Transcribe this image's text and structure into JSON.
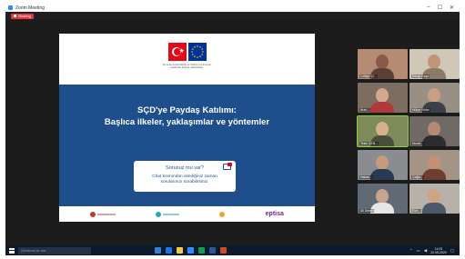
{
  "window": {
    "title": "Zoom Meeting",
    "controls": [
      "–",
      "☐",
      "✕"
    ]
  },
  "share_bar": {
    "label": "Sharing"
  },
  "slide": {
    "logo_caption_line1": "Bu proje Avrupa Birliği ve Türkiye Cumhuriyeti",
    "logo_caption_line2": "tarafından finanse edilmektedir.",
    "title_line1": "SÇD'ye Paydaş Katılımı:",
    "title_line2": "Başlıca ilkeler, yaklaşımlar ve yöntemler",
    "note_question": "Sorunuz mu var?",
    "note_line1": "Chat kısmından istediğiniz zaman",
    "note_line2": "sorularınızı sorabilirsiniz.",
    "partner_logos": [
      "partner-logo-1",
      "partner-logo-2",
      "partner-logo-3"
    ],
    "partner_eptisa": "eptisa"
  },
  "participants": [
    {
      "name": "Lütfiye Şİ..."
    },
    {
      "name": "Serap Kaya"
    },
    {
      "name": "Arzu..."
    },
    {
      "name": "Hülya Yıldız"
    },
    {
      "name": "Tekin ŞEN..."
    },
    {
      "name": "Murat..."
    },
    {
      "name": "Hakan..."
    },
    {
      "name": "Çağla..."
    },
    {
      "name": "Ali Demir"
    },
    {
      "name": "Ece..."
    }
  ],
  "taskbar": {
    "search_placeholder": "Windows'ta ara",
    "time": "11:03",
    "date": "22.05.2020"
  },
  "colors": {
    "slide_band": "#1e4f8c",
    "active_speaker_border": "#8fce3c",
    "share_pill": "#e0393e"
  }
}
